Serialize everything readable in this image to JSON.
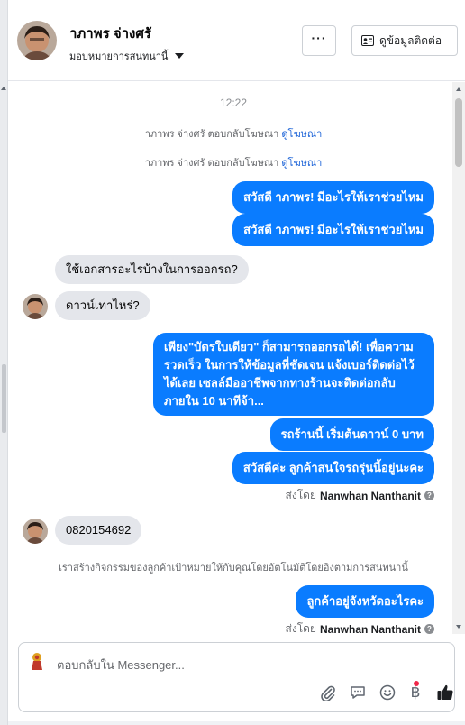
{
  "header": {
    "name": "าภาพร จ่างศรั",
    "assign_label": "มอบหมายการสนทนานี้",
    "more_label": "···",
    "contact_label": "ดูข้อมูลติดต่อ"
  },
  "chat": {
    "time": "12:22",
    "system_notes": [
      {
        "text": "าภาพร จ่างศรั ตอบกลับโฆษณา",
        "link": "ดูโฆษณา"
      },
      {
        "text": "าภาพร จ่างศรั ตอบกลับโฆษณา",
        "link": "ดูโฆษณา"
      }
    ],
    "out_greeting_1": "สวัสดี าภาพร! มีอะไรให้เราช่วยไหม",
    "out_greeting_2": "สวัสดี าภาพร! มีอะไรให้เราช่วยไหม",
    "in_1": "ใช้เอกสารอะไรบ้างในการออกรถ?",
    "in_2": "ดาวน์เท่าไหร่?",
    "out_long": "เพียง\"บัตรใบเดียว\" ก็สามารถออกรถได้! เพื่อความรวดเร็ว ในการให้ข้อมูลที่ชัดเจน แจ้งเบอร์ติดต่อไว้ได้เลย เซลล์มืออาชีพจากทางร้านจะติดต่อกลับภายใน 10 นาทีจ้า...",
    "out_3": "รถร้านนี้ เริ่มต้นดาวน์ 0 บาท",
    "out_4": "สวัสดีค่ะ ลูกค้าสนใจรถรุ่นนี้อยู่นะคะ",
    "sent_by_prefix": "ส่งโดย",
    "sent_by_name": "Nanwhan Nanthanit",
    "in_3": "0820154692",
    "activity_note": "เราสร้างกิจกรรมของลูกค้าเป้าหมายให้กับคุณโดยอัตโนมัติโดยอิงตามการสนทนานี้",
    "out_5": "ลูกค้าอยู่จังหวัดอะไรคะ",
    "sent_by_prefix_2": "ส่งโดย",
    "sent_by_name_2": "Nanwhan Nanthanit"
  },
  "composer": {
    "placeholder": "ตอบกลับใน Messenger...",
    "tools": [
      "paperclip-icon",
      "chat-bubble-icon",
      "emoji-icon",
      "baht-icon",
      "like-icon"
    ],
    "baht_glyph": "฿"
  },
  "colors": {
    "outgoing_bubble": "#0a7cff",
    "incoming_bubble": "#e4e6eb",
    "link": "#1d64d8"
  }
}
